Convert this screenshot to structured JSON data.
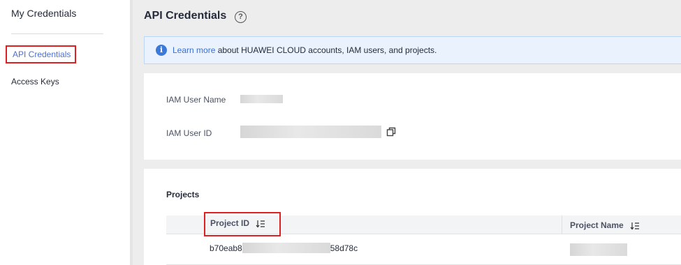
{
  "sidebar": {
    "title": "My Credentials",
    "items": [
      {
        "label": "API Credentials"
      },
      {
        "label": "Access Keys"
      }
    ]
  },
  "header": {
    "title": "API Credentials",
    "help_icon": "question-circle-icon"
  },
  "info": {
    "link": "Learn more",
    "text": " about HUAWEI CLOUD accounts, IAM users, and projects.",
    "icon": "info-icon"
  },
  "user_info": {
    "user_name_label": "IAM User Name",
    "user_id_label": "IAM User ID",
    "copy_icon": "copy-icon"
  },
  "projects": {
    "title": "Projects",
    "columns": [
      "Project ID",
      "Project Name"
    ],
    "rows": [
      {
        "project_id_start": "b70eab8",
        "project_id_end": "58d78c"
      }
    ],
    "sort_icon": "sort-icon"
  },
  "colors": {
    "accent": "#526ecc",
    "highlight_border": "#e02020",
    "info_bg": "#e9f2fd"
  }
}
